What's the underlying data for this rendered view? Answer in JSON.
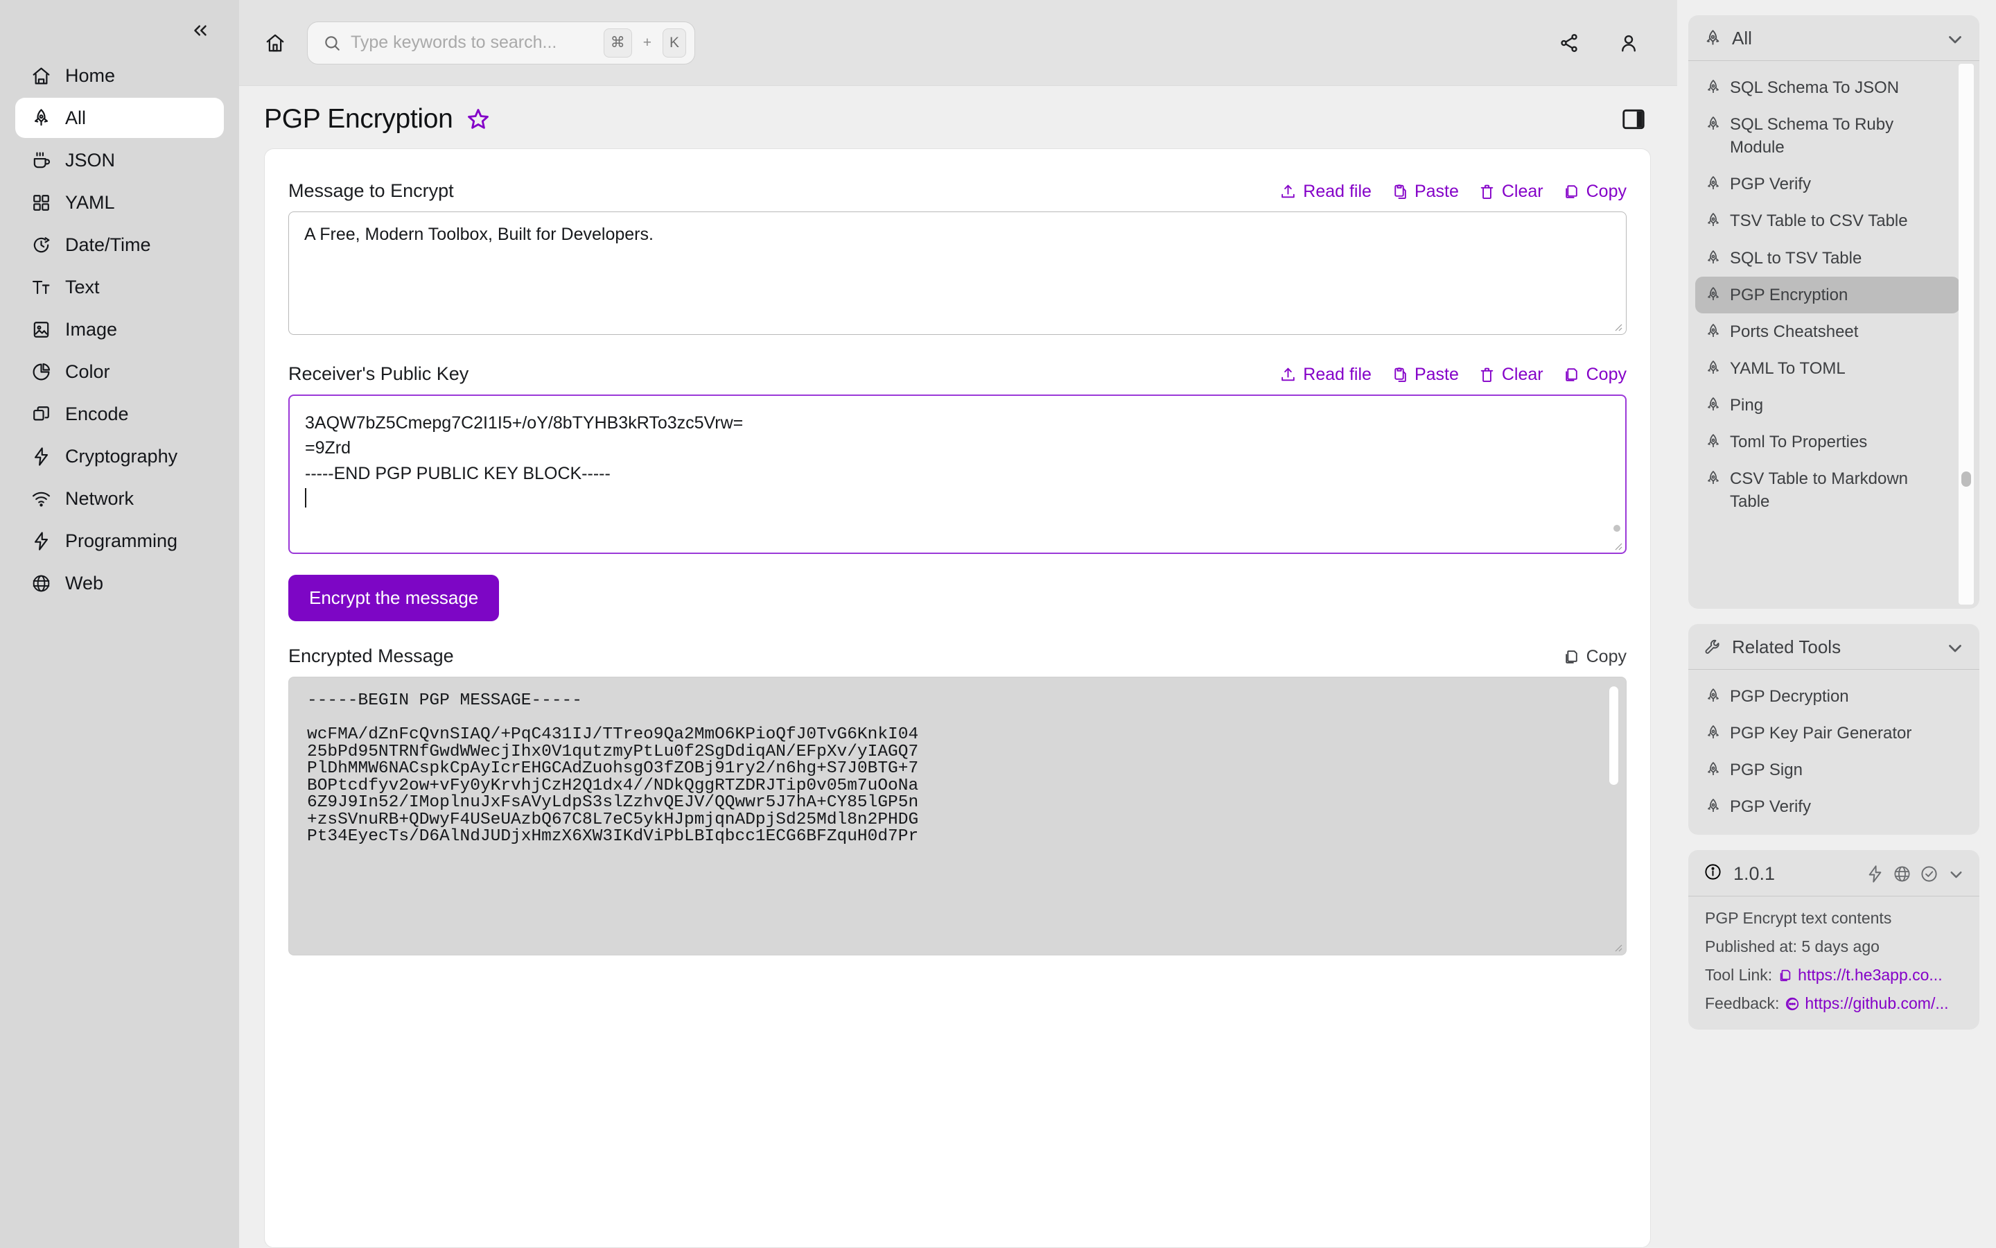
{
  "sidebar": {
    "collapse_icon": "chevrons-left-icon",
    "items": [
      {
        "label": "Home",
        "icon": "home-icon",
        "active": false
      },
      {
        "label": "All",
        "icon": "rocket-icon",
        "active": true
      },
      {
        "label": "JSON",
        "icon": "coffee-icon",
        "active": false
      },
      {
        "label": "YAML",
        "icon": "grid-icon",
        "active": false
      },
      {
        "label": "Date/Time",
        "icon": "clock-icon",
        "active": false
      },
      {
        "label": "Text",
        "icon": "text-icon",
        "active": false
      },
      {
        "label": "Image",
        "icon": "image-icon",
        "active": false
      },
      {
        "label": "Color",
        "icon": "pie-chart-icon",
        "active": false
      },
      {
        "label": "Encode",
        "icon": "layers-icon",
        "active": false
      },
      {
        "label": "Cryptography",
        "icon": "bolt-icon",
        "active": false
      },
      {
        "label": "Network",
        "icon": "wifi-icon",
        "active": false
      },
      {
        "label": "Programming",
        "icon": "bolt-icon",
        "active": false
      },
      {
        "label": "Web",
        "icon": "globe-icon",
        "active": false
      }
    ]
  },
  "topbar": {
    "home_icon": "home-icon",
    "search": {
      "placeholder": "Type keywords to search...",
      "value": "",
      "icon": "search-icon",
      "shortcut_key1": "⌘",
      "shortcut_plus": "+",
      "shortcut_key2": "K"
    },
    "share_icon": "share-icon",
    "account_icon": "user-icon"
  },
  "page": {
    "title": "PGP Encryption",
    "favorite_icon": "star-icon",
    "panel_toggle_icon": "sidebar-toggle-icon"
  },
  "message_field": {
    "label": "Message to Encrypt",
    "value": "A Free, Modern Toolbox, Built for Developers.",
    "actions": [
      {
        "label": "Read file",
        "icon": "upload-icon"
      },
      {
        "label": "Paste",
        "icon": "clipboard-icon"
      },
      {
        "label": "Clear",
        "icon": "trash-icon"
      },
      {
        "label": "Copy",
        "icon": "copy-icon"
      }
    ]
  },
  "key_field": {
    "label": "Receiver's Public Key",
    "actions": [
      {
        "label": "Read file",
        "icon": "upload-icon"
      },
      {
        "label": "Paste",
        "icon": "clipboard-icon"
      },
      {
        "label": "Clear",
        "icon": "trash-icon"
      },
      {
        "label": "Copy",
        "icon": "copy-icon"
      }
    ],
    "visible_lines": [
      "3AQW7bZ5Cmepg7C2I1I5+/oY/8bTYHB3kRTo3zc5Vrw=",
      "=9Zrd",
      "-----END PGP PUBLIC KEY BLOCK-----"
    ],
    "focused": true,
    "caret_on_last_line": true
  },
  "encrypt_button": {
    "label": "Encrypt the message"
  },
  "output_field": {
    "label": "Encrypted Message",
    "copy_label": "Copy",
    "copy_icon": "copy-icon",
    "value": "-----BEGIN PGP MESSAGE-----\n\nwcFMA/dZnFcQvnSIAQ/+PqC431IJ/TTreo9Qa2MmO6KPioQfJ0TvG6KnkI04\n25bPd95NTRNfGwdWWecjIhx0V1qutzmyPtLu0f2SgDdiqAN/EFpXv/yIAGQ7\nPlDhMMW6NACspkCpAyIcrEHGCAdZuohsgO3fZOBj91ry2/n6hg+S7J0BTG+7\nBOPtcdfyv2ow+vFy0yKrvhjCzH2Q1dx4//NDkQggRTZDRJTip0v05m7uOoNa\n6Z9J9In52/IMoplnuJxFsAVyLdpS3slZzhvQEJV/QQwwr5J7hA+CY85lGP5n\n+zsSVnuRB+QDwyF4USeUAzbQ67C8L7eC5ykHJpmjqnADpjSd25Mdl8n2PHDG\nPt34EyecTs/D6AlNdJUDjxHmzX6XW3IKdViPbLBIqbcc1ECG6BFZquH0d7Pr"
  },
  "right_panel": {
    "all_card": {
      "title": "All",
      "icon": "rocket-icon",
      "chevron_icon": "chevron-down-icon",
      "items": [
        {
          "label": "SQL Schema To JSON",
          "active": false
        },
        {
          "label": "SQL Schema To Ruby Module",
          "active": false
        },
        {
          "label": "PGP Verify",
          "active": false
        },
        {
          "label": "TSV Table to CSV Table",
          "active": false
        },
        {
          "label": "SQL to TSV Table",
          "active": false
        },
        {
          "label": "PGP Encryption",
          "active": true
        },
        {
          "label": "Ports Cheatsheet",
          "active": false
        },
        {
          "label": "YAML To TOML",
          "active": false
        },
        {
          "label": "Ping",
          "active": false
        },
        {
          "label": "Toml To Properties",
          "active": false
        },
        {
          "label": "CSV Table to Markdown Table",
          "active": false
        }
      ]
    },
    "related_card": {
      "title": "Related Tools",
      "icon": "wrench-icon",
      "chevron_icon": "chevron-down-icon",
      "items": [
        {
          "label": "PGP Decryption"
        },
        {
          "label": "PGP Key Pair Generator"
        },
        {
          "label": "PGP Sign"
        },
        {
          "label": "PGP Verify"
        }
      ]
    },
    "info_card": {
      "icon": "info-icon",
      "version": "1.0.1",
      "head_icons": [
        "bolt-icon",
        "globe-icon",
        "check-circle-icon",
        "chevron-down-icon"
      ],
      "description": "PGP Encrypt text contents",
      "published": "Published at: 5 days ago",
      "tool_link_label": "Tool Link:",
      "tool_link_url": "https://t.he3app.co...",
      "tool_link_icon": "copy-icon",
      "feedback_label": "Feedback:",
      "feedback_url": "https://github.com/...",
      "feedback_icon": "message-icon"
    }
  },
  "colors": {
    "accent": "#8400c8",
    "button": "#7d06c5",
    "focus_border": "#9b39d8",
    "sidebar_bg": "#d8d8d8",
    "output_bg": "#d7d7d7"
  }
}
